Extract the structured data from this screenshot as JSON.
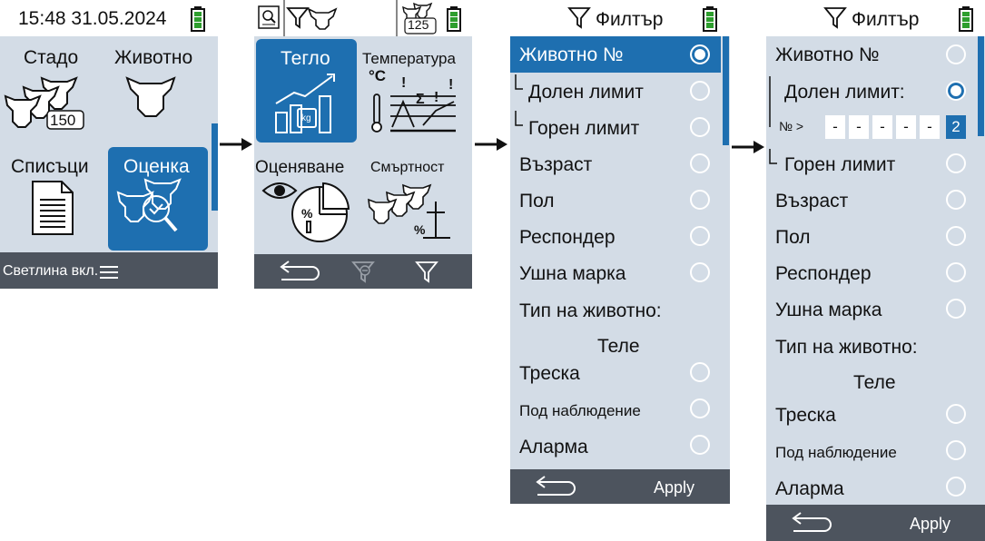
{
  "screen1": {
    "status_time": "15:48 31.05.2024",
    "menu": {
      "herd": "Стадо",
      "animal": "Животно",
      "lists": "Списъци",
      "evaluation": "Оценка",
      "herd_count": "150"
    },
    "bottom_label": "Светлина вкл."
  },
  "screen2": {
    "status_count": "125",
    "tiles": {
      "weight": "Тегло",
      "temperature": "Температура",
      "scoring": "Оценяване",
      "mortality": "Смъртност",
      "celsius": "°C",
      "kg": "kg"
    }
  },
  "screen3": {
    "title": "Филтър",
    "items": [
      {
        "label": "Животно №",
        "selected": true
      },
      {
        "label": "Долен лимит",
        "selected": false
      },
      {
        "label": "Горен лимит",
        "selected": false
      },
      {
        "label": "Възраст",
        "selected": false
      },
      {
        "label": "Пол",
        "selected": false
      },
      {
        "label": "Респондер",
        "selected": false
      },
      {
        "label": "Ушна марка",
        "selected": false
      }
    ],
    "animal_type_label": "Тип на животно:",
    "animal_type_value": "Теле",
    "items2": [
      {
        "label": "Треска"
      },
      {
        "label": "Под наблюдение"
      },
      {
        "label": "Аларма"
      }
    ],
    "apply": "Apply"
  },
  "screen4": {
    "title": "Филтър",
    "animal_no": "Животно №",
    "lower_limit": "Долен лимит:",
    "no_prefix": "№ >",
    "digits": [
      "-",
      "-",
      "-",
      "-",
      "-",
      "2"
    ],
    "upper_limit": "Горен лимит",
    "items": [
      {
        "label": "Възраст"
      },
      {
        "label": "Пол"
      },
      {
        "label": "Респондер"
      },
      {
        "label": "Ушна марка"
      }
    ],
    "animal_type_label": "Тип на животно:",
    "animal_type_value": "Теле",
    "items2": [
      {
        "label": "Треска"
      },
      {
        "label": "Под наблюдение"
      },
      {
        "label": "Аларма"
      }
    ],
    "apply": "Apply"
  },
  "colors": {
    "accent": "#1e6fb0",
    "screen_bg": "#d3dce6",
    "bottom_bar": "#4d545e",
    "battery": "#2e9e2e"
  }
}
